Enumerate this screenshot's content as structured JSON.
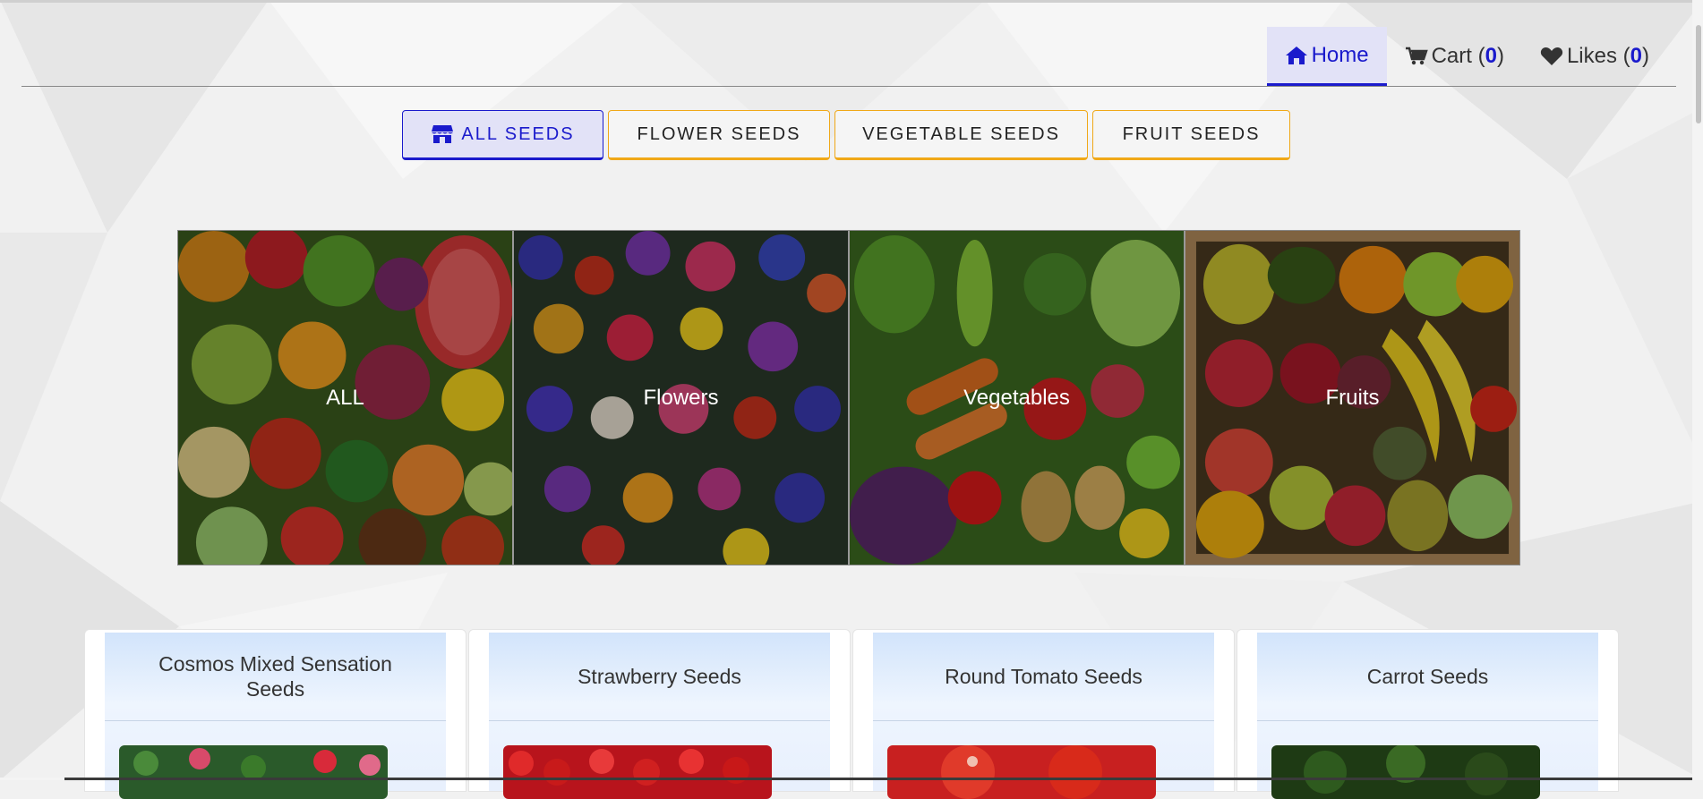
{
  "nav": {
    "home": {
      "label": "Home",
      "icon": "home-icon"
    },
    "cart": {
      "label": "Cart (",
      "count": "0",
      "close": ")",
      "icon": "cart-icon"
    },
    "likes": {
      "label": "Likes (",
      "count": "0",
      "close": ")",
      "icon": "heart-icon"
    },
    "active": "Home"
  },
  "tabs": [
    {
      "label": "ALL SEEDS",
      "active": true,
      "icon": "store-icon"
    },
    {
      "label": "FLOWER SEEDS",
      "active": false
    },
    {
      "label": "VEGETABLE SEEDS",
      "active": false
    },
    {
      "label": "FRUIT SEEDS",
      "active": false
    }
  ],
  "banner": [
    {
      "label": "ALL"
    },
    {
      "label": "Flowers"
    },
    {
      "label": "Vegetables"
    },
    {
      "label": "Fruits"
    }
  ],
  "products": [
    {
      "title": "Cosmos Mixed Sensation Seeds"
    },
    {
      "title": "Strawberry Seeds"
    },
    {
      "title": "Round Tomato Seeds"
    },
    {
      "title": "Carrot Seeds"
    }
  ],
  "colors": {
    "accent": "#1a1acc",
    "tab_border": "#f0a818",
    "active_bg": "#e2e2f7"
  }
}
